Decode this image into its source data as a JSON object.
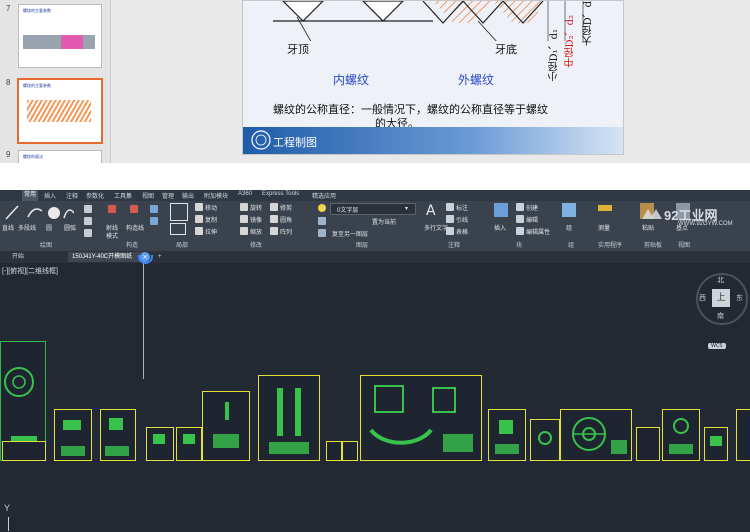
{
  "ppt": {
    "thumbnails": [
      {
        "number": "7",
        "title": "螺纹的主要参数"
      },
      {
        "number": "8",
        "title": "螺纹的主要参数"
      },
      {
        "number": "9",
        "title": "螺纹的画法"
      }
    ],
    "slide": {
      "label_crest": "牙顶",
      "label_root": "牙底",
      "label_internal": "内螺纹",
      "label_external": "外螺纹",
      "label_minor": "小径D₁、d₁",
      "label_pitch": "中径D₂、d₂",
      "label_major": "大径D、d",
      "body_line1": "螺纹的公称直径：一般情况下，螺纹的公称直径等于螺纹",
      "body_line2": "的大径。",
      "footer": "工程制图"
    }
  },
  "cad": {
    "menu": [
      "常用",
      "插入",
      "注释",
      "参数化",
      "工具集",
      "视图",
      "管理",
      "输出",
      "附加模块",
      "A360",
      "Express Tools",
      "精选应用"
    ],
    "active_menu": "常用",
    "ribbon": {
      "draw": {
        "line": "直线",
        "polyline": "多段线",
        "circle": "圆",
        "arc": "圆弧"
      },
      "modify": {
        "move": "移动",
        "rotate": "旋转",
        "trim": "修剪",
        "copy": "复制",
        "mirror": "镜像",
        "fillet": "圆角",
        "stretch": "拉伸",
        "scale": "缩放",
        "array": "阵列"
      },
      "layers": {
        "layer_name": "0文字层",
        "match": "置为当前",
        "set_current": "复至另一图层"
      },
      "annotation": {
        "text": "多行文字",
        "dimension": "标注",
        "leader": "引线",
        "table": "表格"
      },
      "block": {
        "insert": "插入",
        "create": "创建",
        "edit": "编辑",
        "edit_attr": "编辑属性"
      },
      "groups": {
        "group": "组"
      },
      "utilities": {
        "measure": "测量"
      },
      "clipboard": {
        "paste": "粘贴"
      },
      "view": {
        "base": "基点"
      },
      "extra_labels": {
        "construct": "构造线",
        "hatch": "射线",
        "mode": "模式"
      },
      "group_titles": [
        "绘图",
        "构造",
        "局部",
        "修改",
        "图层",
        "注释",
        "块",
        "组",
        "实用程序",
        "剪贴板",
        "视图"
      ]
    },
    "tabs": {
      "start": "开始",
      "doc": "150J41Y-40C开模图纸",
      "plus": "+"
    },
    "viewport_label": "[-][俯视][二维线框]",
    "viewcube": {
      "top": "上",
      "north": "北",
      "south": "南",
      "east": "东",
      "west": "西",
      "wcs": "WCS"
    },
    "axis_y": "Y",
    "watermark": {
      "logo": "92工业网",
      "url": "WWW.92GYW.COM"
    }
  },
  "colors": {
    "accent": "#e66a2e",
    "sheet_border": "#e2e23a",
    "drawing_green": "#38c24c",
    "slide_blue": "#2a49c7"
  }
}
